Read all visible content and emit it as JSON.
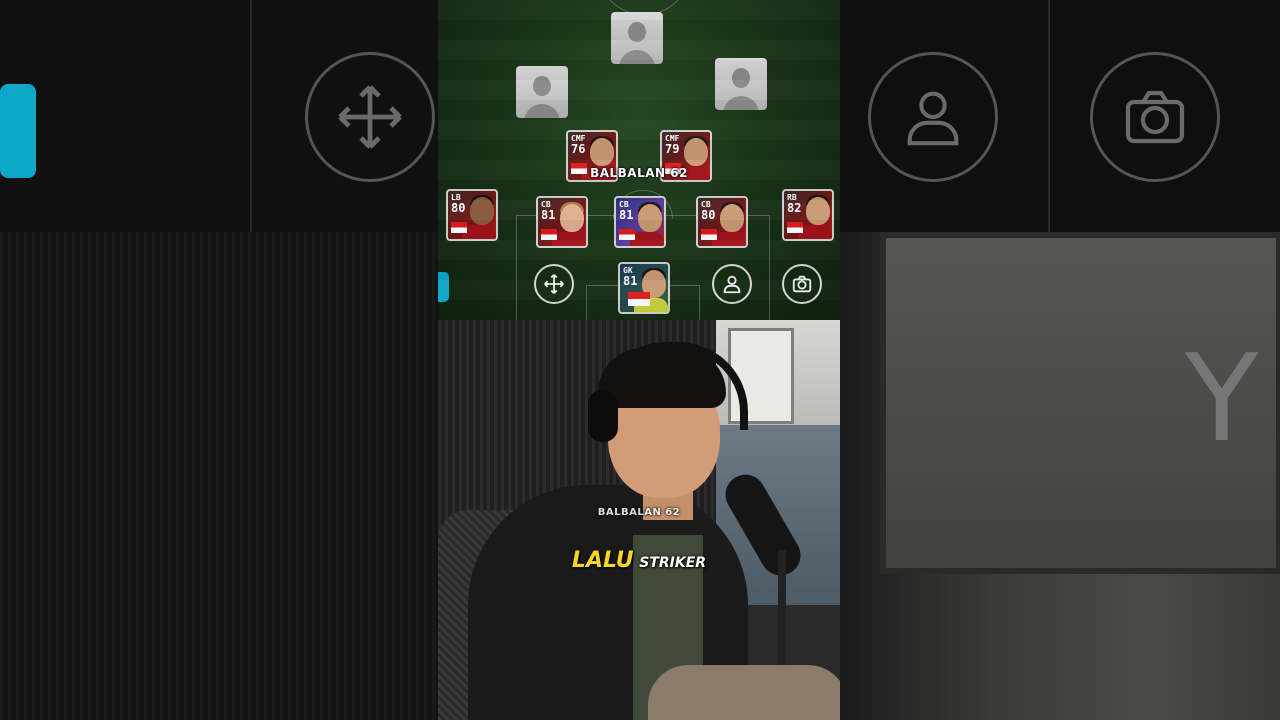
{
  "formation": {
    "forwards": [
      {
        "name": "empty-slot-top"
      },
      {
        "name": "empty-slot-left"
      },
      {
        "name": "empty-slot-right"
      }
    ],
    "midfield": [
      {
        "pos": "CMF",
        "rating": "76"
      },
      {
        "pos": "CMF",
        "rating": "79"
      }
    ],
    "defense": [
      {
        "pos": "LB",
        "rating": "80"
      },
      {
        "pos": "CB",
        "rating": "81"
      },
      {
        "pos": "CB",
        "rating": "81"
      },
      {
        "pos": "CB",
        "rating": "80"
      },
      {
        "pos": "RB",
        "rating": "82"
      }
    ],
    "goalkeeper": {
      "pos": "GK",
      "rating": "81"
    }
  },
  "watermark_top": "BALBALAN 62",
  "watermark_video": "BALBALAN 62",
  "controls": {
    "move_icon": "move-arrows-icon",
    "person_icon": "person-icon",
    "camera_icon": "camera-icon"
  },
  "subtitle": {
    "highlight": "LALU",
    "rest": "STRIKER"
  },
  "colors": {
    "accent_cyan": "#0fa7c9",
    "subtitle_yellow": "#f4d623",
    "team_red": "#b41e1e"
  }
}
